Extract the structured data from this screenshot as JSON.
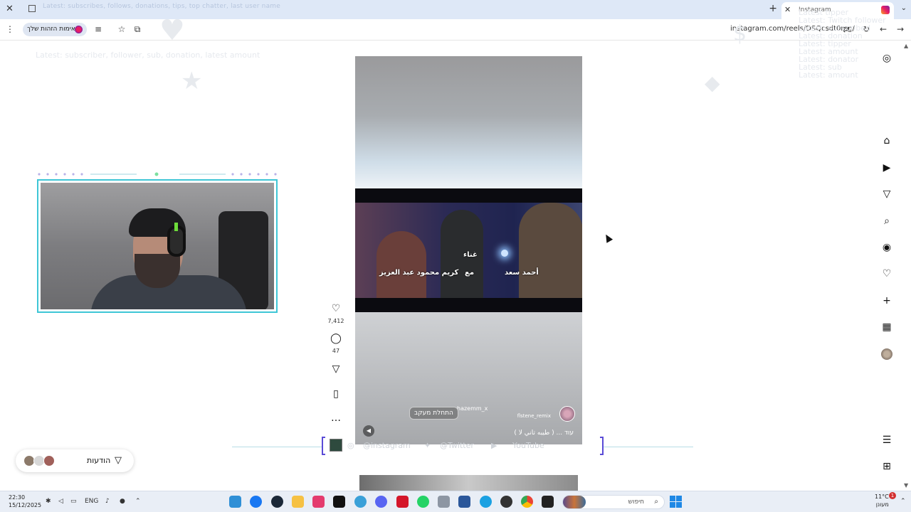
{
  "browser": {
    "tab_title": "Instagram",
    "url": "instagram.com/reels/DSQcsdt0mg/",
    "overlay_ticker": "Latest: subscribes, follows, donations, tips, top chatter, last user name",
    "verify_identity": "אימות הזהות שלך"
  },
  "overlay": {
    "top_left_text": "Latest: subscriber, follower, sub, donation, latest amount",
    "top_right_lines": [
      "Latest tipper",
      "Latest: Twitch follower",
      "Latest: subscribed",
      "Latest: donation",
      "Latest: tipper",
      "Latest: amount",
      "Latest: donator",
      "Latest: sub",
      "Latest: amount"
    ]
  },
  "reel": {
    "subtitles": {
      "singing": "غناء",
      "with": "مع",
      "artist_left": "كريم محمود عبد العزيز",
      "artist_right": "أحمد سعد"
    },
    "username": "flstene_remix",
    "follow_button": "התחלת מעקב",
    "tagged_user": "hazemm_x",
    "caption": "( طيبه تاني لا ) ... עוד"
  },
  "actions": {
    "likes": "7,412",
    "comments": "47"
  },
  "social_bar": {
    "instagram": "@instagram",
    "twitter": "@Twitter",
    "youtube": "YouTube"
  },
  "notifications": {
    "label": "הודעות"
  },
  "taskbar": {
    "time": "22:30",
    "date": "15/12/2025",
    "language": "ENG",
    "search_placeholder": "חיפוש",
    "weather_temp": "11°C",
    "weather_desc": "מעונן",
    "badge": "1"
  },
  "colors": {
    "accent_cyan": "#3ec6d6",
    "bracket_purple": "#5a4bd6",
    "taskbar_bg": "#e9eef6",
    "tab_bar": "#dee8f7"
  }
}
